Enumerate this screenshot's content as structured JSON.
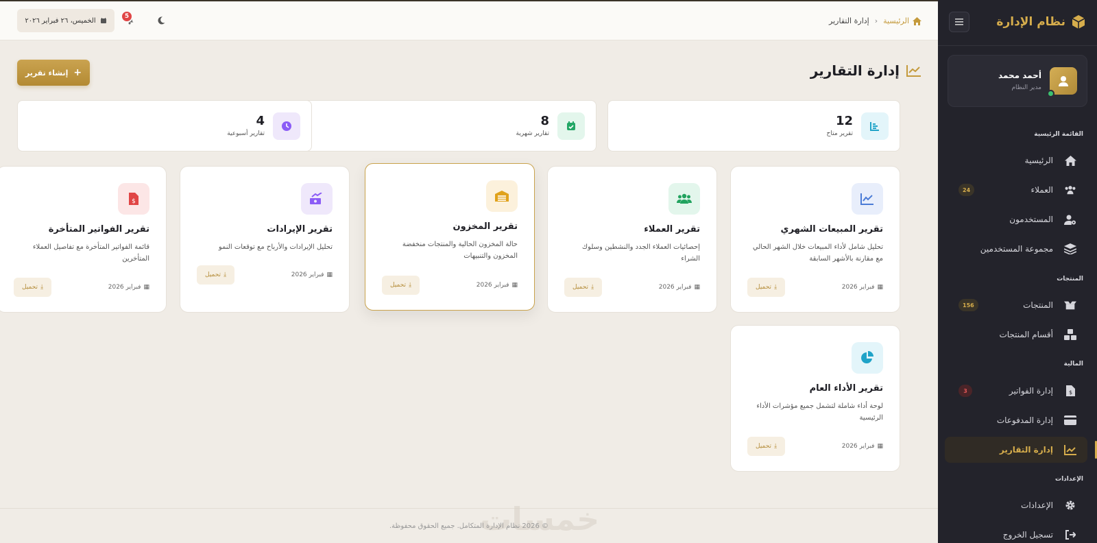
{
  "sidebar": {
    "brand": "نظام الإدارة",
    "user": {
      "name": "أحمد محمد",
      "role": "مدير النظام"
    },
    "sections": [
      {
        "title": "القائمة الرئيسية"
      },
      {
        "title": "المنتجات"
      },
      {
        "title": "المالية"
      },
      {
        "title": "الإعدادات"
      }
    ],
    "items": [
      {
        "label": "الرئيسية",
        "icon": "home-icon"
      },
      {
        "label": "العملاء",
        "icon": "users-icon",
        "badge": "24"
      },
      {
        "label": "المستخدمون",
        "icon": "user-gear-icon"
      },
      {
        "label": "مجموعة المستخدمين",
        "icon": "layers-icon"
      },
      {
        "label": "المنتجات",
        "icon": "box-open-icon",
        "badge": "156"
      },
      {
        "label": "أقسام المنتجات",
        "icon": "cubes-icon"
      },
      {
        "label": "إدارة الفواتير",
        "icon": "invoice-icon",
        "badge": "3"
      },
      {
        "label": "إدارة المدفوعات",
        "icon": "credit-card-icon"
      },
      {
        "label": "إدارة التقارير",
        "icon": "chart-line-icon",
        "active": true
      },
      {
        "label": "الإعدادات",
        "icon": "gear-icon"
      },
      {
        "label": "تسجيل الخروج",
        "icon": "logout-icon"
      }
    ]
  },
  "header": {
    "date": "الخميس، ٢٦ فبراير ٢٠٢٦",
    "notifications": "5",
    "breadcrumb": {
      "home": "الرئيسية",
      "current": "إدارة التقارير"
    }
  },
  "page": {
    "title": "إدارة التقارير",
    "create_button": "إنشاء تقرير"
  },
  "stats": [
    {
      "value": "12",
      "label": "تقرير متاح",
      "icon": "list-chart-icon",
      "color": "#1fa3c8"
    },
    {
      "value": "8",
      "label": "تقارير شهرية",
      "icon": "calendar-check-icon",
      "color": "#23a766"
    },
    {
      "value": "4",
      "label": "تقارير أسبوعية",
      "icon": "clock-icon",
      "color": "#8b5cf6"
    }
  ],
  "reports": [
    {
      "title": "تقرير المبيعات الشهري",
      "desc": "تحليل شامل لأداء المبيعات خلال الشهر الحالي مع مقارنة بالأشهر السابقة",
      "date": "فبراير 2026",
      "download": "تحميل",
      "icon": "chart-line-icon",
      "color": "#4a7bd6"
    },
    {
      "title": "تقرير العملاء",
      "desc": "إحصائيات العملاء الجدد والنشطين وسلوك الشراء",
      "date": "فبراير 2026",
      "download": "تحميل",
      "icon": "users-icon",
      "color": "#22a35f"
    },
    {
      "title": "تقرير المخزون",
      "desc": "حالة المخزون الحالية والمنتجات منخفضة المخزون والتنبيهات",
      "date": "فبراير 2026",
      "download": "تحميل",
      "icon": "warehouse-icon",
      "color": "#e0a21c"
    },
    {
      "title": "تقرير الإيرادات",
      "desc": "تحليل الإيرادات والأرباح مع توقعات النمو",
      "date": "فبراير 2026",
      "download": "تحميل",
      "icon": "money-trend-icon",
      "color": "#8b5cf6"
    },
    {
      "title": "تقرير الفواتير المتأخرة",
      "desc": "قائمة الفواتير المتأخرة مع تفاصيل العملاء المتأخرين",
      "date": "فبراير 2026",
      "download": "تحميل",
      "icon": "invoice-dollar-icon",
      "color": "#e04545"
    },
    {
      "title": "تقرير الأداء العام",
      "desc": "لوحة أداء شاملة لتشمل جميع مؤشرات الأداء الرئيسية",
      "date": "فبراير 2026",
      "download": "تحميل",
      "icon": "pie-chart-icon",
      "color": "#1fa3c8"
    }
  ],
  "footer": "© 2026 نظام الإدارة المتكامل. جميع الحقوق محفوظة.",
  "watermark": "خمسات"
}
